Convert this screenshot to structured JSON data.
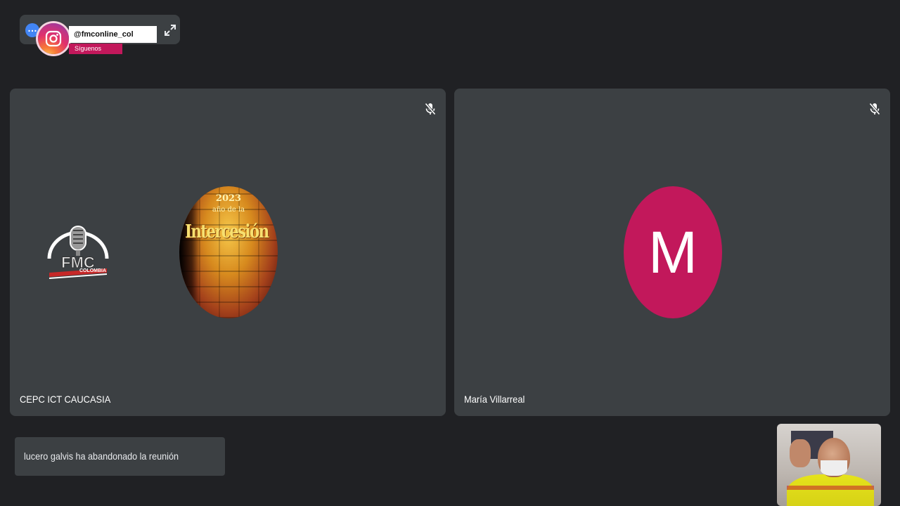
{
  "top_bar": {
    "instagram_handle": "@fmconline_col",
    "follow_label": "Síguenos"
  },
  "tiles": [
    {
      "name": "CEPC ICT CAUCASIA",
      "mic_state": "muted",
      "avatar_type": "image",
      "avatar_text": {
        "year": "2023",
        "subtitle": "año de la",
        "title": "Intercesión"
      },
      "overlay_logo": {
        "main": "FMC",
        "sub": "COLOMBIA"
      }
    },
    {
      "name": "María Villarreal",
      "mic_state": "muted",
      "avatar_type": "initial",
      "avatar_initial": "M",
      "avatar_color": "#c2185b"
    }
  ],
  "toast": {
    "message": "lucero galvis ha abandonado la reunión"
  },
  "colors": {
    "background": "#202124",
    "tile": "#3c4043",
    "instagram_follow": "#c2185b",
    "accent_blue": "#4285f4"
  }
}
